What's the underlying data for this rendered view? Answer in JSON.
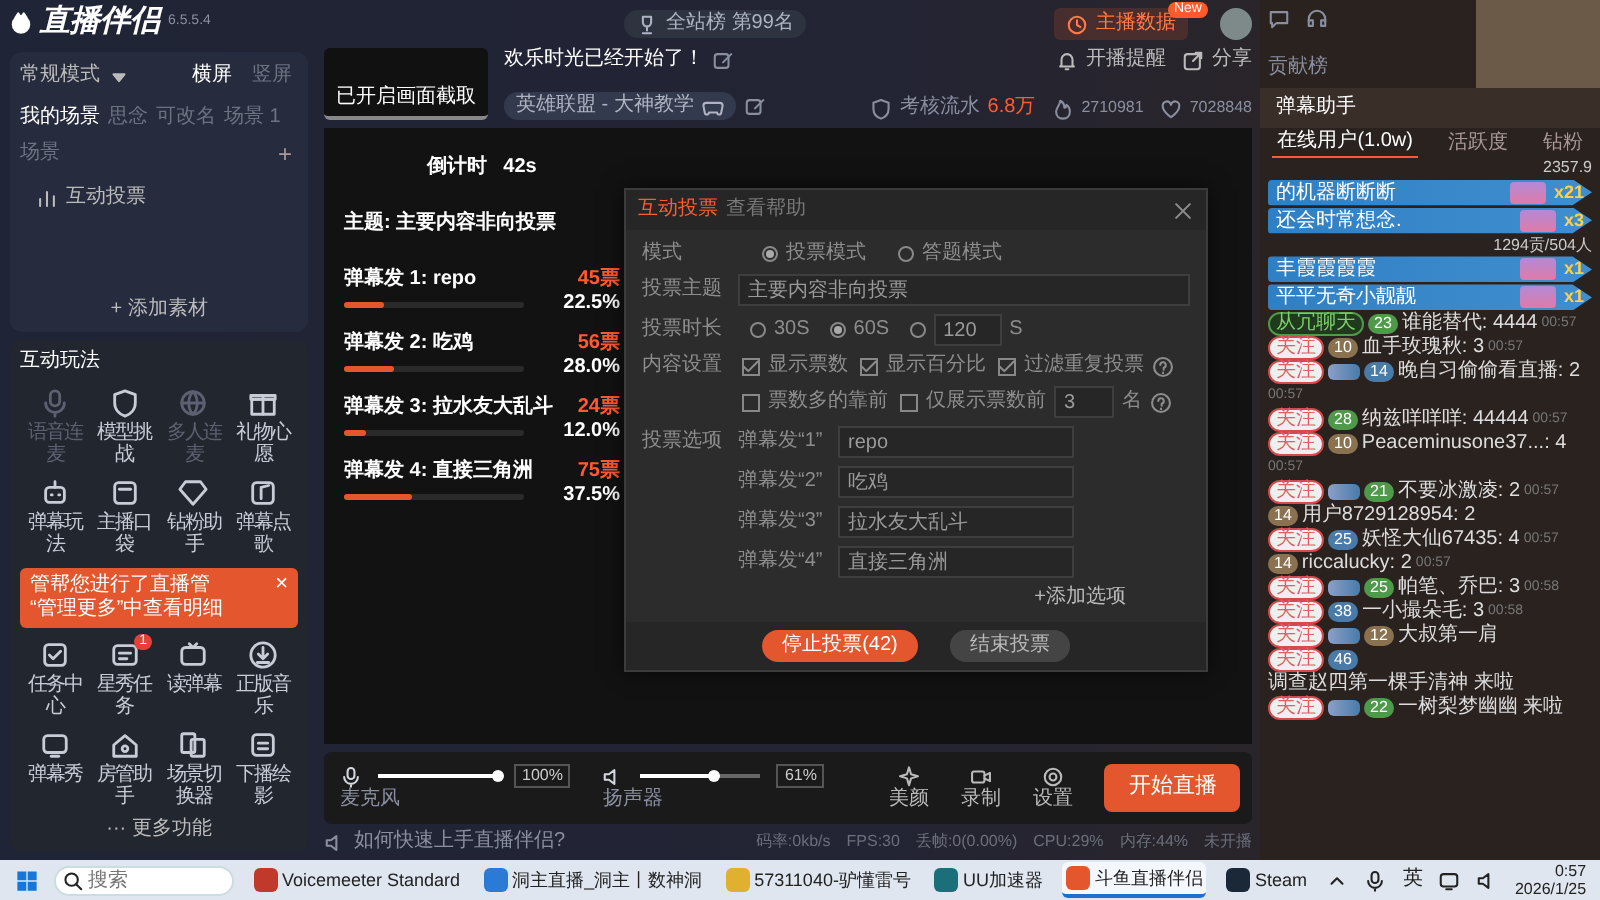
{
  "app": {
    "logo": "直播伴侣",
    "version": "6.5.5.4"
  },
  "scenes": {
    "mode": "常规模式",
    "orientations": [
      {
        "label": "横屏",
        "selected": true
      },
      {
        "label": "竖屏",
        "selected": false
      }
    ],
    "tabs": [
      {
        "label": "我的场景",
        "selected": true
      },
      {
        "label": "思念",
        "selected": false
      },
      {
        "label": "可改名",
        "selected": false
      },
      {
        "label": "场景 1",
        "selected": false
      },
      {
        "label": "场景",
        "selected": false
      }
    ],
    "add_tab": "+",
    "items": [
      {
        "label": "互动投票"
      }
    ],
    "add_material": "+ 添加素材"
  },
  "interactions": {
    "title": "互动玩法",
    "tools_top": [
      {
        "label": "语音连麦",
        "disabled": true
      },
      {
        "label": "模型挑战",
        "disabled": false
      },
      {
        "label": "多人连麦",
        "disabled": true
      },
      {
        "label": "礼物心愿",
        "disabled": false
      },
      {
        "label": "弹幕玩法",
        "disabled": false
      },
      {
        "label": "主播口袋",
        "disabled": false
      },
      {
        "label": "钻粉助手",
        "disabled": false
      },
      {
        "label": "弹幕点歌",
        "disabled": false
      }
    ],
    "notice": {
      "lines": [
        "管帮您进行了直播管",
        "“管理更多”中查看明细"
      ],
      "close": "×"
    },
    "tools_bottom": [
      {
        "label": "任务中心",
        "disabled": false
      },
      {
        "label": "星秀任务",
        "disabled": false,
        "badge": "1"
      },
      {
        "label": "读弹幕",
        "disabled": false
      },
      {
        "label": "正版音乐",
        "disabled": false
      },
      {
        "label": "弹幕秀",
        "disabled": false
      },
      {
        "label": "房管助手",
        "disabled": false
      },
      {
        "label": "场景切换器",
        "disabled": false
      },
      {
        "label": "下播绘影",
        "disabled": false
      }
    ],
    "more": "··· 更多功能"
  },
  "header": {
    "data_button": "主播数据",
    "new_badge": "New",
    "thumbnail": "已开启画面截取",
    "title": "欢乐时光已经开始了！",
    "category": "英雄联盟 - 大神教学",
    "rank": "全站榜",
    "rank_value": "第99名",
    "remind": "开播提醒",
    "share": "分享",
    "flow_label": "考核流水",
    "flow_value": "6.8万",
    "hot": "2710981",
    "likes": "7028848"
  },
  "vote_overlay": {
    "countdown_label": "倒计时",
    "countdown": "42s",
    "topic": "主题: 主要内容非向投票",
    "options": [
      {
        "label": "弹幕发 1:  repo",
        "votes": "45票",
        "percent": "22.5%",
        "level": 0.225
      },
      {
        "label": "弹幕发 2:  吃鸡",
        "votes": "56票",
        "percent": "28.0%",
        "level": 0.28
      },
      {
        "label": "弹幕发 3:  拉水友大乱斗",
        "votes": "24票",
        "percent": "12.0%",
        "level": 0.12
      },
      {
        "label": "弹幕发 4:  直接三角洲",
        "votes": "75票",
        "percent": "37.5%",
        "level": 0.375
      }
    ]
  },
  "dialog": {
    "tabs": [
      {
        "label": "互动投票",
        "selected": true
      },
      {
        "label": "查看帮助",
        "selected": false
      }
    ],
    "mode_label": "模式",
    "modes": [
      {
        "label": "投票模式",
        "selected": true
      },
      {
        "label": "答题模式",
        "selected": false
      }
    ],
    "topic_label": "投票主题",
    "topic": "主要内容非向投票",
    "duration_label": "投票时长",
    "durations": [
      {
        "kind": "preset",
        "label": "30S",
        "selected": false
      },
      {
        "kind": "preset",
        "label": "60S",
        "selected": true
      },
      {
        "kind": "custom",
        "value": "120",
        "unit": "S",
        "selected": false
      }
    ],
    "content_label": "内容设置",
    "checks_row1": [
      {
        "label": "显示票数",
        "checked": true
      },
      {
        "label": "显示百分比",
        "checked": true
      },
      {
        "label": "过滤重复投票",
        "checked": true,
        "help": true
      }
    ],
    "checks_row2": [
      {
        "label": "票数多的靠前",
        "checked": false
      },
      {
        "label": "仅展示票数前",
        "checked": false,
        "value": "3",
        "unit": "名",
        "help": true
      }
    ],
    "options_label": "投票选项",
    "options": [
      {
        "label": "弹幕发“1”",
        "value": "repo"
      },
      {
        "label": "弹幕发“2”",
        "value": "吃鸡"
      },
      {
        "label": "弹幕发“3”",
        "value": "拉水友大乱斗"
      },
      {
        "label": "弹幕发“4”",
        "value": "直接三角洲"
      }
    ],
    "add_option": "+添加选项",
    "buttons": [
      {
        "kind": "primary",
        "label": "停止投票(42)"
      },
      {
        "kind": "secondary",
        "label": "结束投票"
      }
    ]
  },
  "controls": {
    "mic": {
      "label": "麦克风",
      "level": 1,
      "reading": "100%"
    },
    "speaker": {
      "label": "扬声器",
      "level": 0.61,
      "reading": "61%"
    },
    "tools": [
      {
        "label": "美颜"
      },
      {
        "label": "录制"
      },
      {
        "label": "设置"
      }
    ],
    "start": "开始直播"
  },
  "status": {
    "help": "如何快速上手直播伴侣?",
    "stats": [
      "码率:0kb/s",
      "FPS:30",
      "丢帧:0(0.00%)",
      "CPU:29%",
      "内存:44%",
      "未开播"
    ]
  },
  "right": {
    "contrib": "贡献榜",
    "assistant": "弹幕助手",
    "tabs": [
      {
        "label": "在线用户(1.0w)",
        "selected": true
      },
      {
        "label": "活跃度",
        "selected": false
      },
      {
        "label": "钻粉",
        "selected": false
      }
    ],
    "feed": [
      {
        "kind": "stat",
        "text": "2357.9"
      },
      {
        "kind": "banner",
        "name": "的机器断断断",
        "count": "x21"
      },
      {
        "kind": "banner",
        "name": "还会时常想念.",
        "count": "x3"
      },
      {
        "kind": "stat",
        "text": "1294贡/504人"
      },
      {
        "kind": "banner",
        "name": "丰霞霞霞霞",
        "count": "x1"
      },
      {
        "kind": "banner",
        "name": "平平无奇小靓靓",
        "count": "x1"
      },
      {
        "kind": "message",
        "tag": "从冗聊天",
        "rank": "23",
        "color": "#4f9a4a",
        "text": "谁能替代: 4444",
        "time": "00:57"
      },
      {
        "kind": "message",
        "follow": "关注",
        "rank": "10",
        "color": "#8a7250",
        "text": "血手玫瑰秋: 3",
        "time": "00:57"
      },
      {
        "kind": "message",
        "follow": "关注",
        "medal": true,
        "rank": "14",
        "color": "#4a7aa8",
        "text": "晚自习偷偷看直播: 2",
        "time": "00:57"
      },
      {
        "kind": "message",
        "follow": "关注",
        "rank": "28",
        "color": "#4f9a4a",
        "text": "纳兹咩咩咩: 44444",
        "time": "00:57"
      },
      {
        "kind": "message",
        "follow": "关注",
        "rank": "10",
        "color": "#8a7250",
        "text": "Peaceminusone37...: 4",
        "time": "00:57"
      },
      {
        "kind": "message",
        "follow": "关注",
        "medal": true,
        "rank": "21",
        "color": "#4f9a4a",
        "text": "不要冰激凌: 2",
        "time": "00:57"
      },
      {
        "kind": "message",
        "rank": "14",
        "color": "#8a7250",
        "text": "用户8729128954: 2"
      },
      {
        "kind": "message",
        "follow": "关注",
        "rank": "25",
        "color": "#4a7aa8",
        "text": "妖怪大仙67435: 4",
        "time": "00:57"
      },
      {
        "kind": "message",
        "rank": "14",
        "color": "#8a7250",
        "text": "riccalucky: 2",
        "time": "00:57"
      },
      {
        "kind": "message",
        "follow": "关注",
        "medal": true,
        "rank": "25",
        "color": "#4f9a4a",
        "text": "帕笔、乔巴: 3",
        "time": "00:58"
      },
      {
        "kind": "message",
        "follow": "关注",
        "rank": "38",
        "color": "#4a7aa8",
        "text": "一小撮朵毛: 3",
        "time": "00:58"
      },
      {
        "kind": "message",
        "follow": "关注",
        "medal": true,
        "rank": "12",
        "color": "#8a7250",
        "text": "大叔第一肩"
      },
      {
        "kind": "message",
        "follow": "关注",
        "rank": "46",
        "color": "#4a7aa8",
        "text": "调查赵四第一棵手清神 来啦"
      },
      {
        "kind": "message",
        "follow": "关注",
        "medal": true,
        "rank": "22",
        "color": "#4f9a4a",
        "text": "一树梨梦幽幽 来啦"
      }
    ]
  },
  "taskbar": {
    "search": {
      "placeholder": "搜索"
    },
    "apps": [
      {
        "label": "Voicemeeter Standard",
        "selected": false
      },
      {
        "label": "洞主直播_洞主丨数神洞",
        "selected": false
      },
      {
        "label": "57311040-驴懂雷号",
        "selected": false
      },
      {
        "label": "UU加速器",
        "selected": false
      },
      {
        "label": "斗鱼直播伴侣",
        "selected": true
      },
      {
        "label": "Steam",
        "selected": false
      }
    ],
    "ime": "英",
    "time": "0:57",
    "date": "2026/1/25"
  }
}
